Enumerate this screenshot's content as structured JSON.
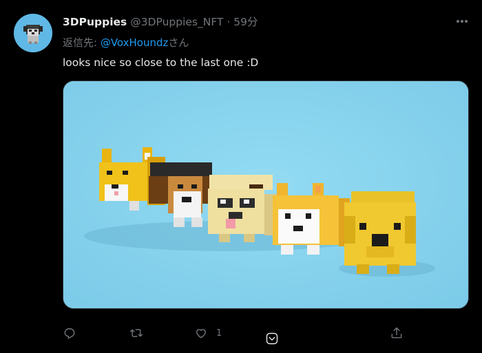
{
  "tweet": {
    "display_name": "3DPuppies",
    "handle": "@3DPuppies_NFT",
    "separator": "·",
    "time": "59分",
    "reply_prefix": "返信先: ",
    "reply_mention": "@VoxHoundz",
    "reply_suffix": "さん",
    "text": "looks nice so close to the last one :D",
    "like_count": "1"
  },
  "colors": {
    "background": "#000000",
    "text": "#e7e9ea",
    "secondary": "#71767b",
    "accent": "#1d9bf0",
    "media_background": "#86d3ee"
  },
  "icons": {
    "more": "more-icon",
    "reply": "reply-icon",
    "retweet": "retweet-icon",
    "like": "heart-icon",
    "nft": "nft-icon",
    "share": "share-icon"
  }
}
